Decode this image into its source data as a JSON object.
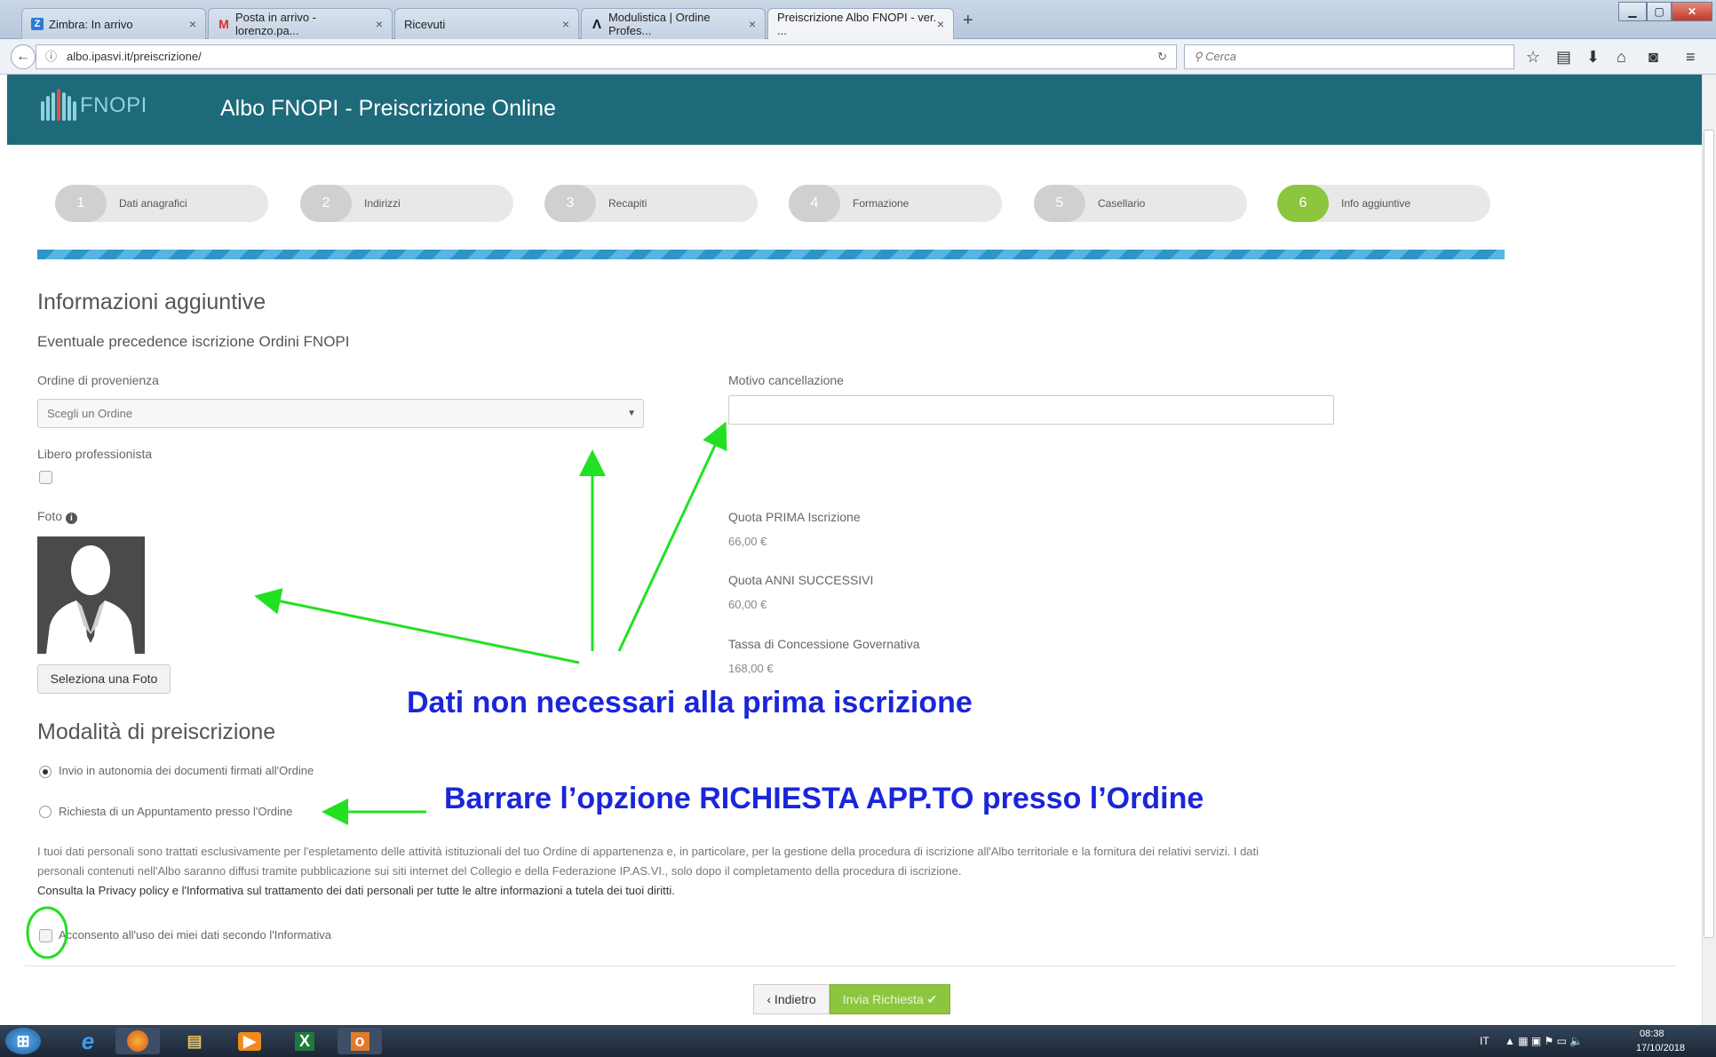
{
  "browser": {
    "tabs": [
      {
        "label": "Zimbra: In arrivo",
        "icon": "zimbra-icon"
      },
      {
        "label": "Posta in arrivo - lorenzo.pa...",
        "icon": "gmail-icon"
      },
      {
        "label": "Ricevuti",
        "icon": "page-icon"
      },
      {
        "label": "Modulistica | Ordine Profes...",
        "icon": "lambda-icon"
      },
      {
        "label": "Preiscrizione Albo FNOPI - ver. ...",
        "icon": "page-icon"
      }
    ],
    "url": "albo.ipasvi.it/preiscrizione/",
    "search_placeholder": "Cerca"
  },
  "app": {
    "logo_text": "FNOPI",
    "title": "Albo FNOPI - Preiscrizione Online"
  },
  "steps": [
    {
      "num": "1",
      "label": "Dati anagrafici"
    },
    {
      "num": "2",
      "label": "Indirizzi"
    },
    {
      "num": "3",
      "label": "Recapiti"
    },
    {
      "num": "4",
      "label": "Formazione"
    },
    {
      "num": "5",
      "label": "Casellario"
    },
    {
      "num": "6",
      "label": "Info aggiuntive"
    }
  ],
  "form": {
    "section_title": "Informazioni aggiuntive",
    "subtitle": "Eventuale precedence iscrizione Ordini FNOPI",
    "ordine_label": "Ordine di provenienza",
    "ordine_value": "Scegli un Ordine",
    "motivo_label": "Motivo cancellazione",
    "libero_label": "Libero professionista",
    "foto_label": "Foto",
    "foto_button": "Seleziona una Foto",
    "fees": [
      {
        "label": "Quota PRIMA Iscrizione",
        "value": "66,00 €"
      },
      {
        "label": "Quota ANNI SUCCESSIVI",
        "value": "60,00 €"
      },
      {
        "label": "Tassa di Concessione Governativa",
        "value": "168,00 €"
      }
    ],
    "modalita_title": "Modalità di preiscrizione",
    "option_1": "Invio in autonomia dei documenti firmati all'Ordine",
    "option_2": "Richiesta di un Appuntamento presso l'Ordine",
    "privacy_1": "I tuoi dati personali sono trattati esclusivamente per l'espletamento delle attività istituzionali del tuo Ordine di appartenenza e, in particolare, per la gestione della procedura di iscrizione all'Albo territoriale e la fornitura dei relativi servizi. I dati",
    "privacy_2": "personali contenuti nell'Albo saranno diffusi tramite pubblicazione sui siti internet del Collegio e della Federazione IP.AS.VI., solo dopo il completamento della procedura di iscrizione.",
    "privacy_3": "Consulta la Privacy policy e l'Informativa sul trattamento dei dati personali per tutte le altre informazioni a tutela dei tuoi diritti.",
    "consent": "Acconsento all'uso dei miei dati secondo l'Informativa",
    "back_button": "‹ Indietro",
    "send_button": "Invia Richiesta ✔"
  },
  "annotations": {
    "note_1": "Dati non necessari alla prima iscrizione",
    "note_2": "Barrare l’opzione RICHIESTA APP.TO presso l’Ordine"
  },
  "taskbar": {
    "lang": "IT",
    "time": "08:38",
    "date": "17/10/2018"
  },
  "colors": {
    "header": "#1d6a7a",
    "accent_green": "#8cc63f",
    "annotation_blue": "#1a26d9",
    "annotation_arrow": "#22e022"
  }
}
